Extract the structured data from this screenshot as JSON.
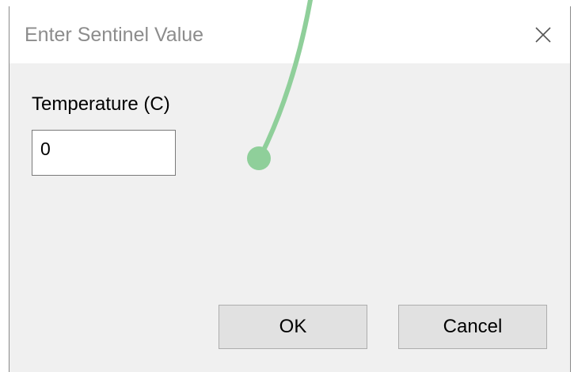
{
  "dialog": {
    "title": "Enter Sentinel Value",
    "close_icon": "close-icon",
    "field_label": "Temperature (C)",
    "field_value": "0",
    "ok_label": "OK",
    "cancel_label": "Cancel"
  },
  "colors": {
    "dialog_background": "#f0f0f0",
    "titlebar_background": "#ffffff",
    "title_text": "#8c8c8c",
    "button_background": "#e1e1e1",
    "cursor_trail": "#8fcf9a"
  }
}
